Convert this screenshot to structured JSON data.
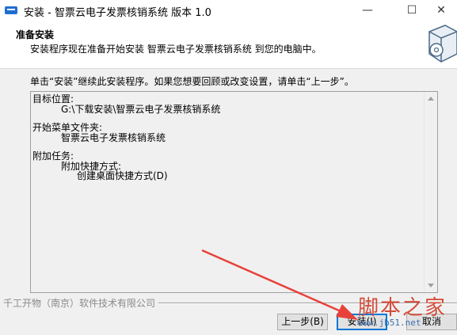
{
  "window": {
    "title": "安装 - 智票云电子发票核销系统 版本 1.0",
    "minimize_glyph": "—",
    "maximize_glyph": "☐",
    "close_glyph": "✕"
  },
  "header": {
    "title": "准备安装",
    "subtitle": "安装程序现在准备开始安装 智票云电子发票核销系统 到您的电脑中。",
    "icon": "installer-box-disc-icon"
  },
  "instruction": "单击“安装”继续此安装程序。如果您想要回顾或改变设置，请单击“上一步”。",
  "memo": {
    "lines": [
      "目标位置:",
      "G:\\下载安装\\智票云电子发票核销系统",
      "",
      "开始菜单文件夹:",
      "智票云电子发票核销系统",
      "",
      "附加任务:",
      "附加快捷方式:",
      "创建桌面快捷方式(D)"
    ]
  },
  "footer": {
    "company": "千工开物（南京）软件技术有限公司"
  },
  "buttons": {
    "back": "上一步(B)",
    "install": "安装(I)",
    "cancel": "取消"
  },
  "watermark": {
    "logo": "脚本之家",
    "url": "www.jb51.net"
  },
  "colors": {
    "arrow": "#e8413a",
    "focus_border": "#0078d7"
  }
}
